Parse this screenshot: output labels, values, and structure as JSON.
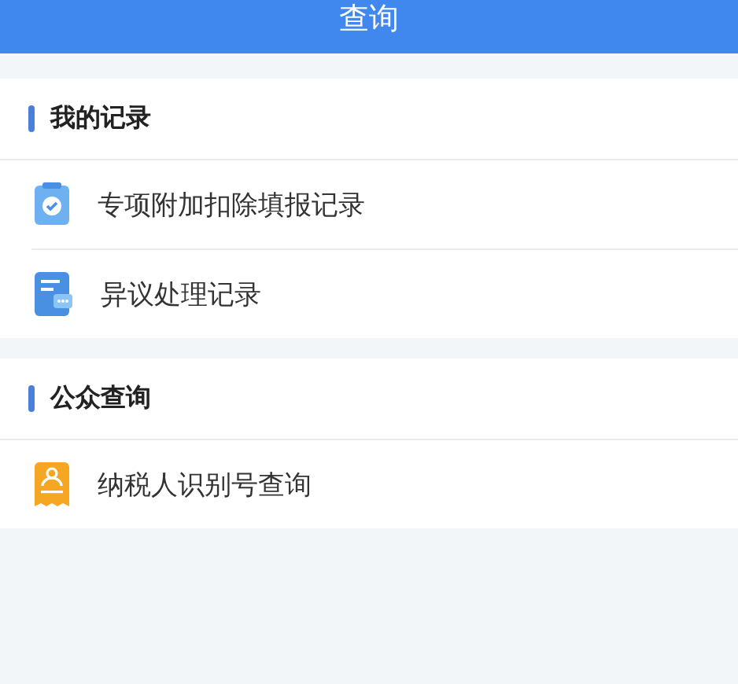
{
  "header": {
    "title": "查询"
  },
  "sections": [
    {
      "title": "我的记录",
      "items": [
        {
          "label": "专项附加扣除填报记录",
          "kind": "clipboard"
        },
        {
          "label": "异议处理记录",
          "kind": "message"
        }
      ]
    },
    {
      "title": "公众查询",
      "items": [
        {
          "label": "纳税人识别号查询",
          "kind": "person"
        }
      ]
    }
  ]
}
